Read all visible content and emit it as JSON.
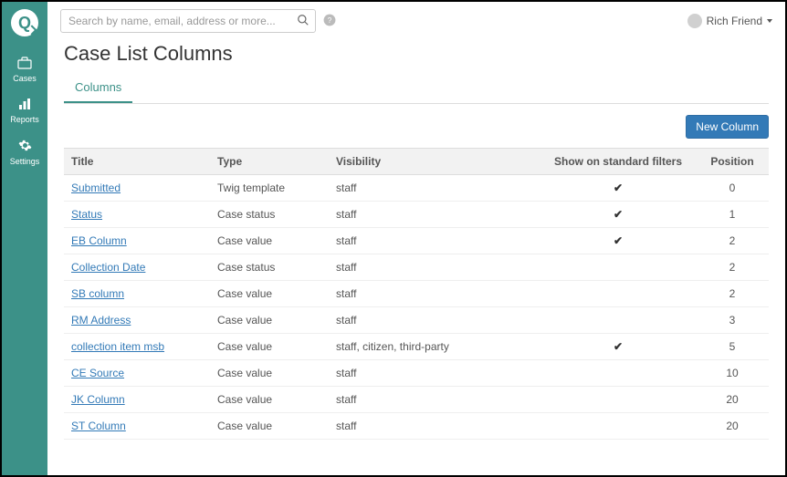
{
  "sidebar": {
    "items": [
      {
        "label": "Cases"
      },
      {
        "label": "Reports"
      },
      {
        "label": "Settings"
      }
    ]
  },
  "topbar": {
    "search_placeholder": "Search by name, email, address or more...",
    "user_name": "Rich Friend"
  },
  "page": {
    "title": "Case List Columns",
    "tab_label": "Columns",
    "new_button": "New Column"
  },
  "table": {
    "headers": {
      "title": "Title",
      "type": "Type",
      "visibility": "Visibility",
      "show_filter": "Show on standard filters",
      "position": "Position"
    },
    "rows": [
      {
        "title": "Submitted",
        "type": "Twig template",
        "visibility": "staff",
        "show_filter": true,
        "position": "0"
      },
      {
        "title": "Status",
        "type": "Case status",
        "visibility": "staff",
        "show_filter": true,
        "position": "1"
      },
      {
        "title": "EB Column",
        "type": "Case value",
        "visibility": "staff",
        "show_filter": true,
        "position": "2"
      },
      {
        "title": "Collection Date",
        "type": "Case status",
        "visibility": "staff",
        "show_filter": false,
        "position": "2"
      },
      {
        "title": "SB column",
        "type": "Case value",
        "visibility": "staff",
        "show_filter": false,
        "position": "2"
      },
      {
        "title": "RM Address",
        "type": "Case value",
        "visibility": "staff",
        "show_filter": false,
        "position": "3"
      },
      {
        "title": "collection item msb",
        "type": "Case value",
        "visibility": "staff, citizen, third-party",
        "show_filter": true,
        "position": "5"
      },
      {
        "title": "CE Source",
        "type": "Case value",
        "visibility": "staff",
        "show_filter": false,
        "position": "10"
      },
      {
        "title": "JK Column",
        "type": "Case value",
        "visibility": "staff",
        "show_filter": false,
        "position": "20"
      },
      {
        "title": "ST Column",
        "type": "Case value",
        "visibility": "staff",
        "show_filter": false,
        "position": "20"
      }
    ]
  }
}
